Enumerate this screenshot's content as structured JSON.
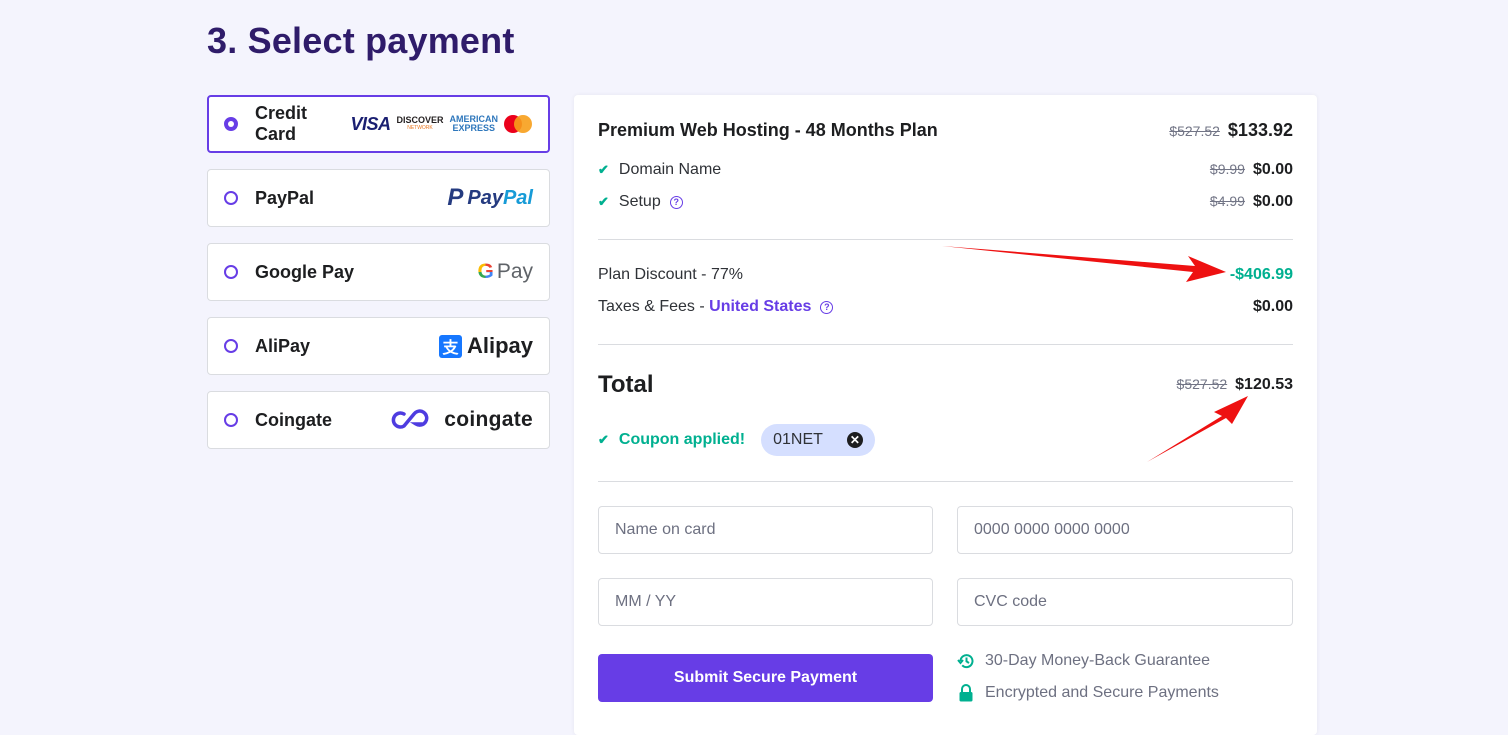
{
  "page_title": "3. Select payment",
  "payment_methods": [
    {
      "label": "Credit Card",
      "selected": true,
      "logos": [
        "VISA",
        "DISCOVER",
        "AMERICAN EXPRESS",
        "mastercard"
      ]
    },
    {
      "label": "PayPal",
      "selected": false,
      "logo_text_a": "Pay",
      "logo_text_b": "Pal"
    },
    {
      "label": "Google Pay",
      "selected": false,
      "logo_g": "G",
      "logo_text": "Pay"
    },
    {
      "label": "AliPay",
      "selected": false,
      "logo_mark": "支",
      "logo_text": "Alipay"
    },
    {
      "label": "Coingate",
      "selected": false,
      "logo_mark": "CG",
      "logo_text": "coingate"
    }
  ],
  "card_logos": {
    "visa": "VISA",
    "discover": "DISCOVER",
    "discover_sub": "NETWORK",
    "amex_line1": "AMERICAN",
    "amex_line2": "EXPRESS",
    "paypal_mark": "P"
  },
  "summary": {
    "plan": {
      "name": "Premium Web Hosting - 48 Months Plan",
      "old_price": "$527.52",
      "price": "$133.92"
    },
    "items": [
      {
        "label": "Domain Name",
        "old_price": "$9.99",
        "price": "$0.00",
        "help": false
      },
      {
        "label": "Setup",
        "old_price": "$4.99",
        "price": "$0.00",
        "help": true
      }
    ],
    "discount": {
      "label": "Plan Discount - 77%",
      "value": "-$406.99"
    },
    "taxes": {
      "label": "Taxes & Fees - ",
      "country": "United States",
      "value": "$0.00"
    },
    "total": {
      "label": "Total",
      "old_price": "$527.52",
      "price": "$120.53"
    },
    "coupon": {
      "status": "Coupon applied!",
      "code": "01NET"
    }
  },
  "form": {
    "name_placeholder": "Name on card",
    "number_placeholder": "0000 0000 0000 0000",
    "expiry_placeholder": "MM / YY",
    "cvc_placeholder": "CVC code",
    "submit_label": "Submit Secure Payment"
  },
  "assurances": [
    {
      "icon": "history-icon",
      "text": "30-Day Money-Back Guarantee"
    },
    {
      "icon": "lock-icon",
      "text": "Encrypted and Secure Payments"
    }
  ],
  "colors": {
    "accent": "#673de6",
    "success": "#00b090",
    "title": "#2f1c6a",
    "annotation": "#ee1111"
  }
}
